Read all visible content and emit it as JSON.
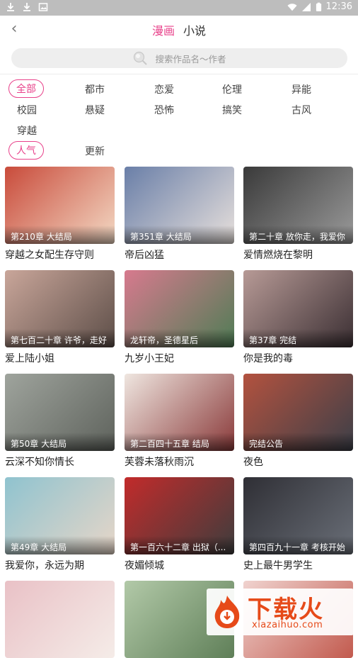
{
  "status": {
    "time": "12:36"
  },
  "header": {
    "back": "‹",
    "tabs": [
      "漫画",
      "小说"
    ]
  },
  "search": {
    "placeholder": "搜索作品名～作者"
  },
  "filters": {
    "genres_row1": [
      "全部",
      "都市",
      "恋爱",
      "伦理",
      "异能"
    ],
    "genres_row2": [
      "校园",
      "悬疑",
      "恐怖",
      "搞笑",
      "古风"
    ],
    "genres_row3": [
      "穿越"
    ],
    "sort": [
      "人气",
      "更新"
    ]
  },
  "books": [
    {
      "chapter": "第210章 大结局",
      "title": "穿越之女配生存守则",
      "cover": [
        "#c94b3b",
        "#f3d9c4"
      ]
    },
    {
      "chapter": "第351章 大结局",
      "title": "帝后凶猛",
      "cover": [
        "#6a7fa8",
        "#e7e0dc"
      ]
    },
    {
      "chapter": "第二十章 放你走，我爱你",
      "title": "爱情燃烧在黎明",
      "cover": [
        "#3a3a3a",
        "#9a9a9a"
      ]
    },
    {
      "chapter": "第七百二十章 许爷，走好",
      "title": "爱上陆小姐",
      "cover": [
        "#c9a69a",
        "#5d4e48"
      ]
    },
    {
      "chapter": "龙轩帝，圣德星后",
      "title": "九岁小王妃",
      "cover": [
        "#d77a8e",
        "#4f7d55"
      ]
    },
    {
      "chapter": "第37章 完结",
      "title": "你是我的毒",
      "cover": [
        "#b79a96",
        "#3b2f33"
      ]
    },
    {
      "chapter": "第50章 大结局",
      "title": "云深不知你情长",
      "cover": [
        "#9fa49d",
        "#5e625c"
      ]
    },
    {
      "chapter": "第二百四十五章 结局",
      "title": "芙蓉未落秋雨沉",
      "cover": [
        "#efe6e0",
        "#8a3a3a"
      ]
    },
    {
      "chapter": "完结公告",
      "title": "夜色",
      "cover": [
        "#b3523f",
        "#3c3f48"
      ]
    },
    {
      "chapter": "第49章 大结局",
      "title": "我爱你，永远为期",
      "cover": [
        "#8fc3cf",
        "#e7d6c8"
      ]
    },
    {
      "chapter": "第一百六十二章 出狱（...",
      "title": "夜媚倾城",
      "cover": [
        "#c22b2b",
        "#3d3d3d"
      ]
    },
    {
      "chapter": "第四百九十一章 考核开始",
      "title": "史上最牛男学生",
      "cover": [
        "#2f2f35",
        "#6a6f78"
      ]
    },
    {
      "chapter": "",
      "title": "",
      "cover": [
        "#e9c1c6",
        "#f5ece8"
      ]
    },
    {
      "chapter": "",
      "title": "",
      "cover": [
        "#b2c9a8",
        "#5f7f58"
      ]
    },
    {
      "chapter": "",
      "title": "",
      "cover": [
        "#f0d3cf",
        "#c25a4e"
      ]
    }
  ],
  "watermark": {
    "text": "下载火",
    "sub": "xiazaihuo.com"
  },
  "colors": {
    "accent": "#e8418a"
  }
}
